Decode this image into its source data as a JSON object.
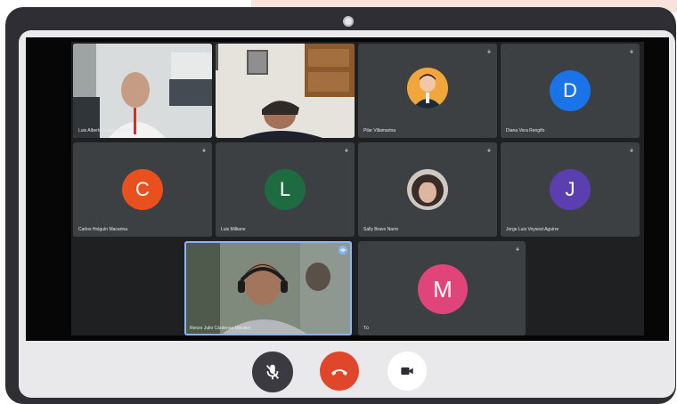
{
  "meeting": {
    "participants": [
      {
        "name": "Luis Alberto Castro Cuadra",
        "kind": "video"
      },
      {
        "name": "",
        "kind": "video"
      },
      {
        "name": "Pilar Villamarina",
        "kind": "photo"
      },
      {
        "name": "Diana Vera Rengifo",
        "kind": "initial",
        "initial": "D",
        "color": "#1a73e8"
      },
      {
        "name": "Carlos Holguín Macarina",
        "kind": "initial",
        "initial": "C",
        "color": "#e8501e"
      },
      {
        "name": "Luis Milliano",
        "kind": "initial",
        "initial": "L",
        "color": "#1e6b42"
      },
      {
        "name": "Sally Bravo Narro",
        "kind": "photo"
      },
      {
        "name": "Jorge Luis Voysest Aguirre",
        "kind": "initial",
        "initial": "J",
        "color": "#5b3fb0"
      },
      {
        "name": "Renzo Julio Cárdenas Morales",
        "kind": "video"
      },
      {
        "name": "Tú",
        "kind": "initial",
        "initial": "M",
        "color": "#e0457a"
      }
    ]
  },
  "controls": {
    "mic": {
      "icon": "mic-off-icon",
      "color": "#3a3a40"
    },
    "hangup": {
      "icon": "phone-hangup-icon",
      "color": "#e0472a"
    },
    "camera": {
      "icon": "video-camera-icon",
      "color": "#ffffff"
    }
  }
}
